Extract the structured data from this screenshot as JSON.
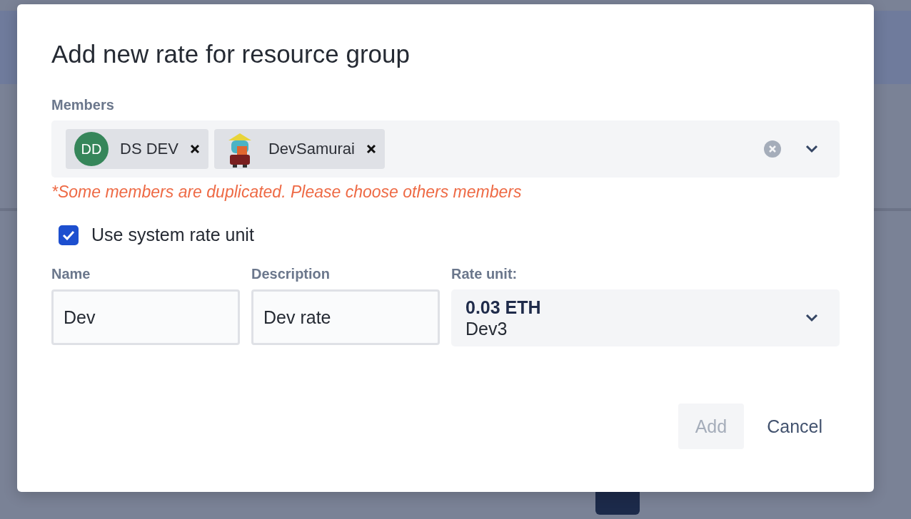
{
  "dialog": {
    "title": "Add new rate for resource group"
  },
  "members": {
    "label": "Members",
    "chips": [
      {
        "name": "DS DEV",
        "initials": "DD",
        "kind": "initials"
      },
      {
        "name": "DevSamurai",
        "kind": "image"
      }
    ],
    "error": "*Some members are duplicated. Please choose others members"
  },
  "use_system_rate": {
    "label": "Use system rate unit",
    "checked": true
  },
  "fields": [
    {
      "label": "Name",
      "value": "Dev"
    },
    {
      "label": "Description",
      "value": "Dev rate"
    }
  ],
  "rate_unit": {
    "label": "Rate unit:",
    "amount": "0.03 ETH",
    "name": "Dev3"
  },
  "buttons": [
    {
      "label": "Add",
      "disabled": true
    },
    {
      "label": "Cancel",
      "disabled": false
    }
  ]
}
